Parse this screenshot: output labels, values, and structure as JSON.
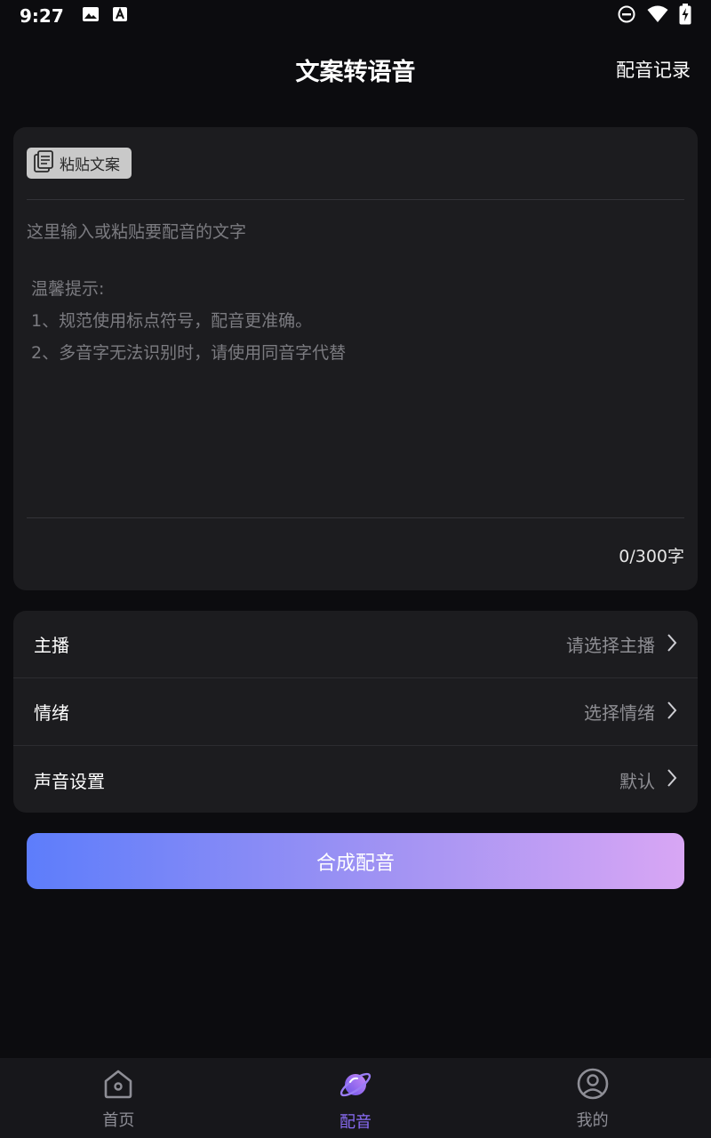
{
  "status_bar": {
    "time": "9:27",
    "left_icons": [
      "image-icon",
      "font-a-icon"
    ],
    "right_icons": [
      "do-not-disturb-icon",
      "wifi-icon",
      "battery-charging-icon"
    ]
  },
  "header": {
    "title": "文案转语音",
    "action_label": "配音记录"
  },
  "editor": {
    "paste_label": "粘贴文案",
    "placeholder": "这里输入或粘贴要配音的文字",
    "tips_title": "温馨提示:",
    "tip_1": "1、规范使用标点符号，配音更准确。",
    "tip_2": "2、多音字无法识别时，请使用同音字代替",
    "counter": "0/300字"
  },
  "settings": [
    {
      "label": "主播",
      "value": "请选择主播"
    },
    {
      "label": "情绪",
      "value": "选择情绪"
    },
    {
      "label": "声音设置",
      "value": "默认"
    }
  ],
  "submit_label": "合成配音",
  "nav": [
    {
      "label": "首页",
      "icon": "home-icon",
      "active": false
    },
    {
      "label": "配音",
      "icon": "planet-icon",
      "active": true
    },
    {
      "label": "我的",
      "icon": "profile-icon",
      "active": false
    }
  ],
  "colors": {
    "background": "#0c0c0f",
    "card": "#1c1c1f",
    "accent": "#8a6cf5",
    "gradient_start": "#5d7dfb",
    "gradient_end": "#d8a6f4"
  }
}
